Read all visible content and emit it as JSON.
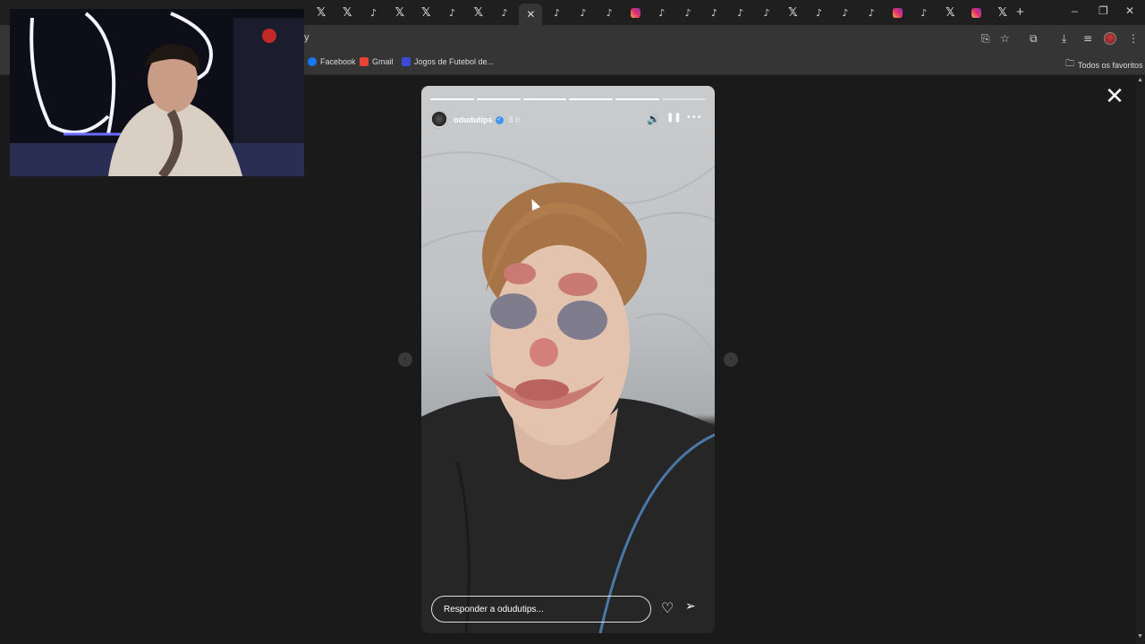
{
  "browser": {
    "tabs": [
      "x",
      "x",
      "tiktok",
      "x",
      "x",
      "tiktok",
      "x",
      "tiktok",
      "close",
      "tiktok",
      "tiktok",
      "tiktok",
      "instagram",
      "tiktok",
      "tiktok",
      "tiktok",
      "tiktok",
      "tiktok",
      "x",
      "tiktok",
      "tiktok",
      "tiktok",
      "instagram",
      "tiktok",
      "x",
      "instagram",
      "x"
    ],
    "new_tab": "+",
    "window": {
      "minimize": "–",
      "restore": "❐",
      "close": "✕"
    },
    "address_fragment": "y",
    "bookmarks": [
      {
        "label": "Facebook",
        "icon": "facebook-icon",
        "color": "#1877f2"
      },
      {
        "label": "Gmail",
        "icon": "gmail-icon",
        "color": "#ea4335"
      },
      {
        "label": "Jogos de Futebol de...",
        "icon": "game-icon",
        "color": "#3b4bd6"
      }
    ],
    "all_bookmarks": "Todos os favoritos"
  },
  "story": {
    "username": "odudutips",
    "time": "8 h",
    "reply_placeholder": "Responder a odudutips...",
    "progress_segments": 6,
    "progress_done": 5,
    "controls": {
      "mute": "🔊",
      "pause": "❚❚",
      "more": "•••"
    },
    "like_icon": "♡",
    "share_icon": "➢"
  },
  "page": {
    "close": "✕",
    "prev": "‹",
    "next": "›"
  }
}
